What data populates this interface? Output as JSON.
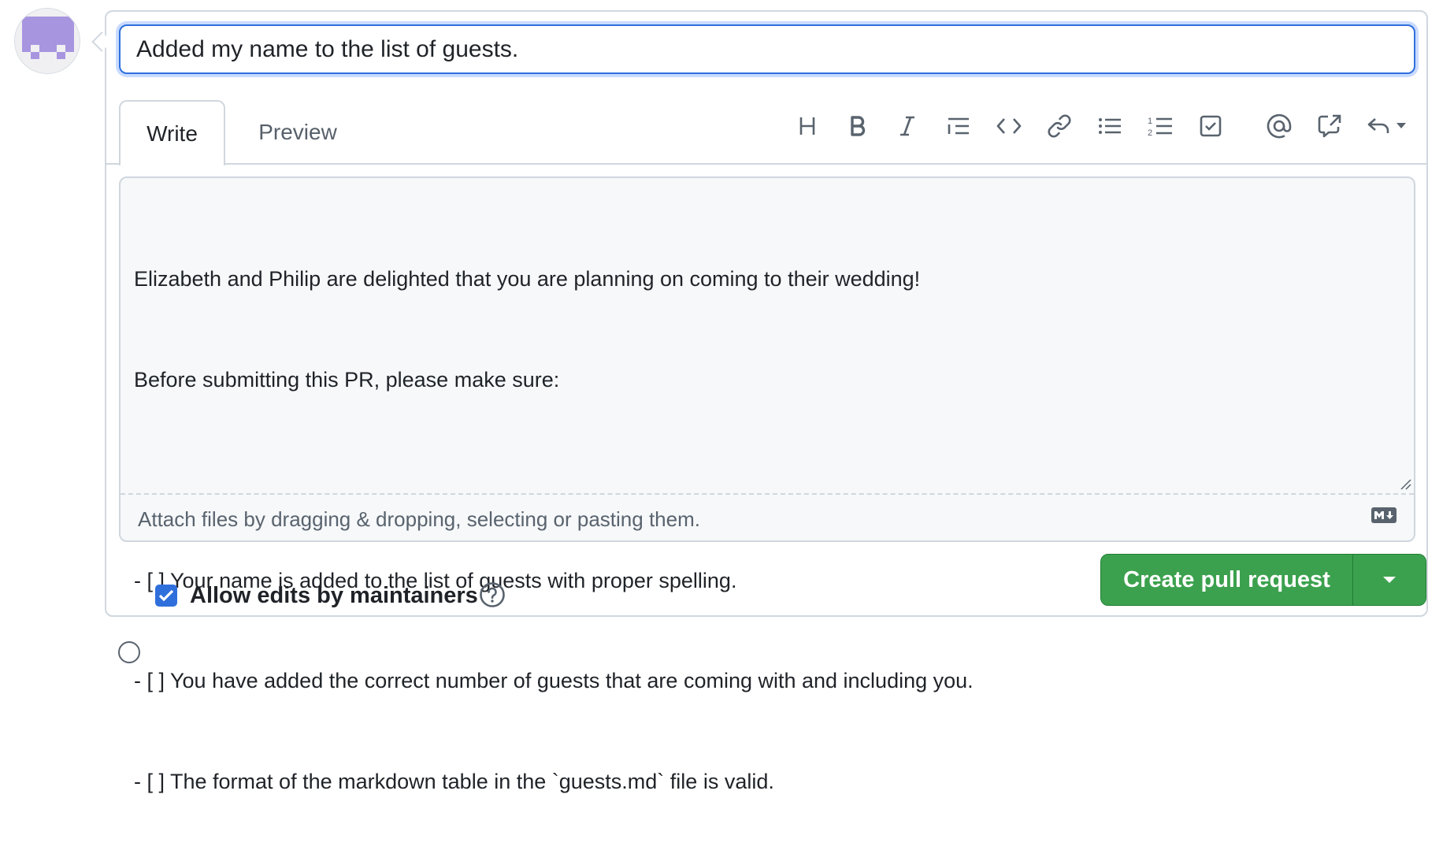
{
  "form": {
    "title_value": "Added my name to the list of guests.",
    "tabs": [
      {
        "label": "Write",
        "active": true
      },
      {
        "label": "Preview",
        "active": false
      }
    ],
    "toolbar": [
      {
        "name": "heading-icon"
      },
      {
        "name": "bold-icon"
      },
      {
        "name": "italic-icon"
      },
      {
        "name": "quote-icon"
      },
      {
        "name": "code-icon"
      },
      {
        "name": "link-icon"
      },
      {
        "name": "unordered-list-icon"
      },
      {
        "name": "ordered-list-icon"
      },
      {
        "name": "task-list-icon"
      },
      {
        "name": "mention-icon"
      },
      {
        "name": "cross-reference-icon"
      },
      {
        "name": "saved-replies-icon"
      }
    ],
    "body_lines": [
      "Elizabeth and Philip are delighted that you are planning on coming to their wedding!",
      "Before submitting this PR, please make sure:",
      "",
      "- [ ] Your name is added to the list of guests with proper spelling.",
      "- [ ] You have added the correct number of guests that are coming with and including you.",
      "- [ ] The format of the markdown table in the `guests.md` file is valid."
    ],
    "attach_hint": "Attach files by dragging & dropping, selecting or pasting them.",
    "allow_edits": {
      "label": "Allow edits by maintainers",
      "checked": true
    },
    "submit_label": "Create pull request"
  },
  "colors": {
    "accent_blue": "#2f6fdc",
    "button_green": "#3ca14e",
    "avatar_purple": "#a795e0"
  }
}
